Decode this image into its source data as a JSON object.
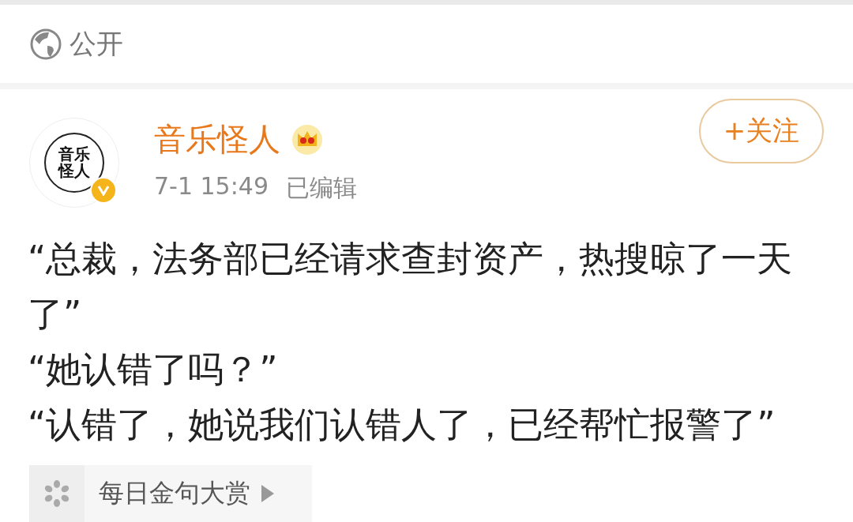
{
  "visibility": {
    "label": "公开"
  },
  "post": {
    "avatar_text": "音乐怪人",
    "verified": true,
    "author": "音乐怪人",
    "crown_badge": true,
    "time": "7-1 15:49",
    "edited": "已编辑",
    "follow_button": "+关注",
    "paragraphs": [
      "“总裁，法务部已经请求查封资产，热搜晾了一天了”",
      "“她认错了吗？”",
      "“认错了，她说我们认错人了，已经帮忙报警了”"
    ],
    "topic": {
      "label": "每日金句大赏"
    }
  }
}
